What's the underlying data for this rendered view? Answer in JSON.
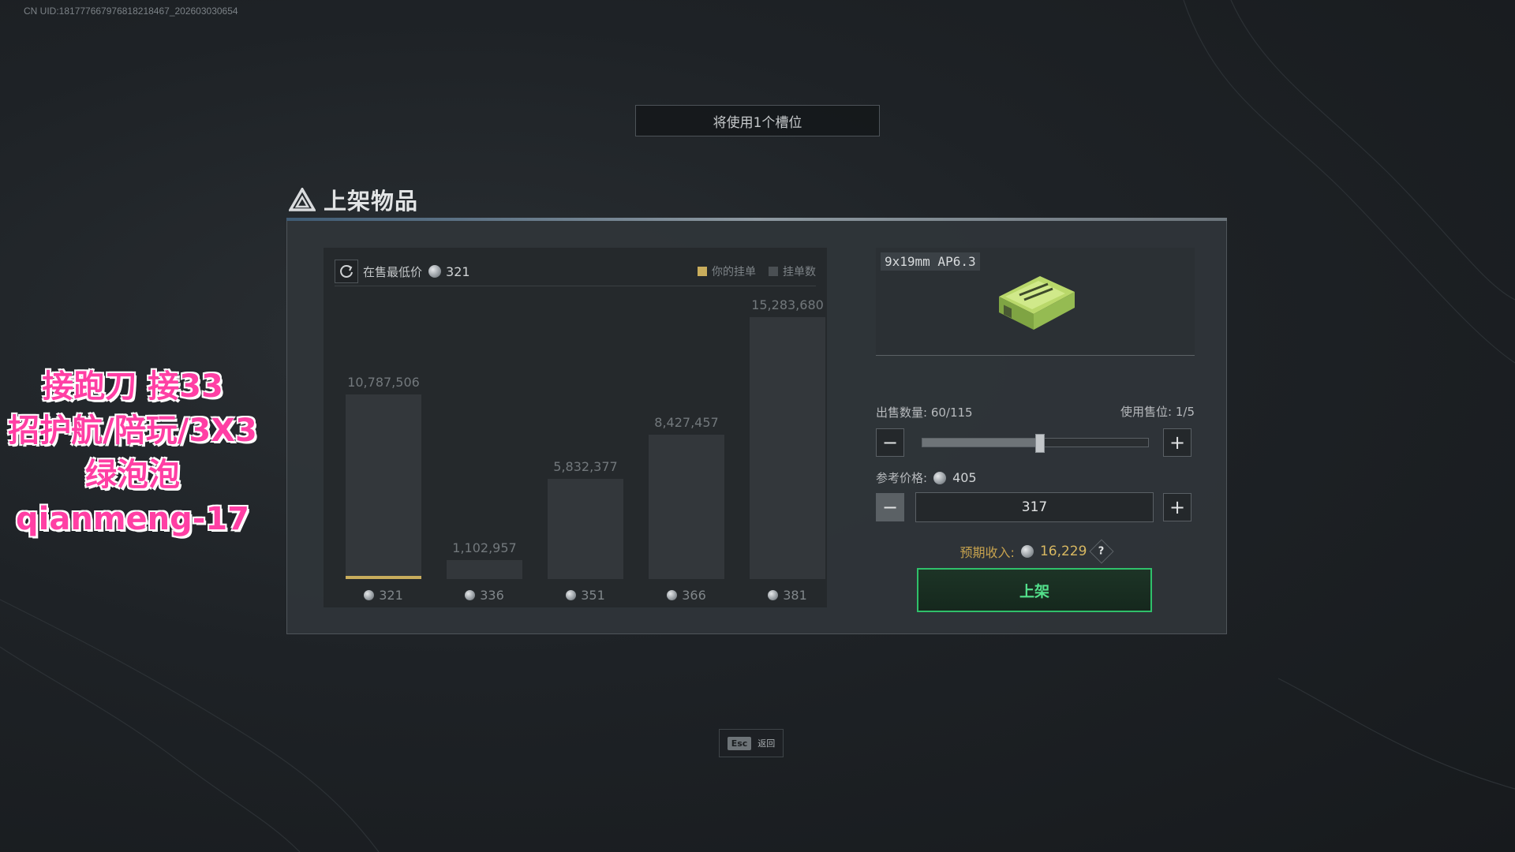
{
  "uid_text": "CN UID:181777667976818218467_202603030654",
  "slot_banner": "将使用1个槽位",
  "panel_title": "上架物品",
  "chart_header": {
    "lowest_label": "在售最低价",
    "lowest_value": "321",
    "legend_yours": "你的挂单",
    "legend_orders": "挂单数",
    "legend_yours_color": "#c9ad5c",
    "legend_orders_color": "#4a4f53"
  },
  "chart_data": {
    "type": "bar",
    "categories": [
      "321",
      "336",
      "351",
      "366",
      "381"
    ],
    "values": [
      10787506,
      1102957,
      5832377,
      8427457,
      15283680
    ],
    "value_labels": [
      "10,787,506",
      "1,102,957",
      "5,832,377",
      "8,427,457",
      "15,283,680"
    ],
    "highlight_index": 0
  },
  "item": {
    "name": "9x19mm AP6.3"
  },
  "sell": {
    "qty_label": "出售数量: 60/115",
    "slot_label": "使用售位: 1/5",
    "qty_fraction": 0.52,
    "ref_label": "参考价格:",
    "ref_value": "405",
    "price_value": "317",
    "income_label": "预期收入:",
    "income_value": "16,229",
    "help_glyph": "?",
    "list_button": "上架",
    "minus_glyph": "−",
    "plus_glyph": "+"
  },
  "esc": {
    "key": "Esc",
    "label": "返回"
  },
  "overlay_lines": [
    "接跑刀 接33",
    "招护航/陪玩/3X3",
    "绿泡泡",
    "qianmeng-17"
  ]
}
